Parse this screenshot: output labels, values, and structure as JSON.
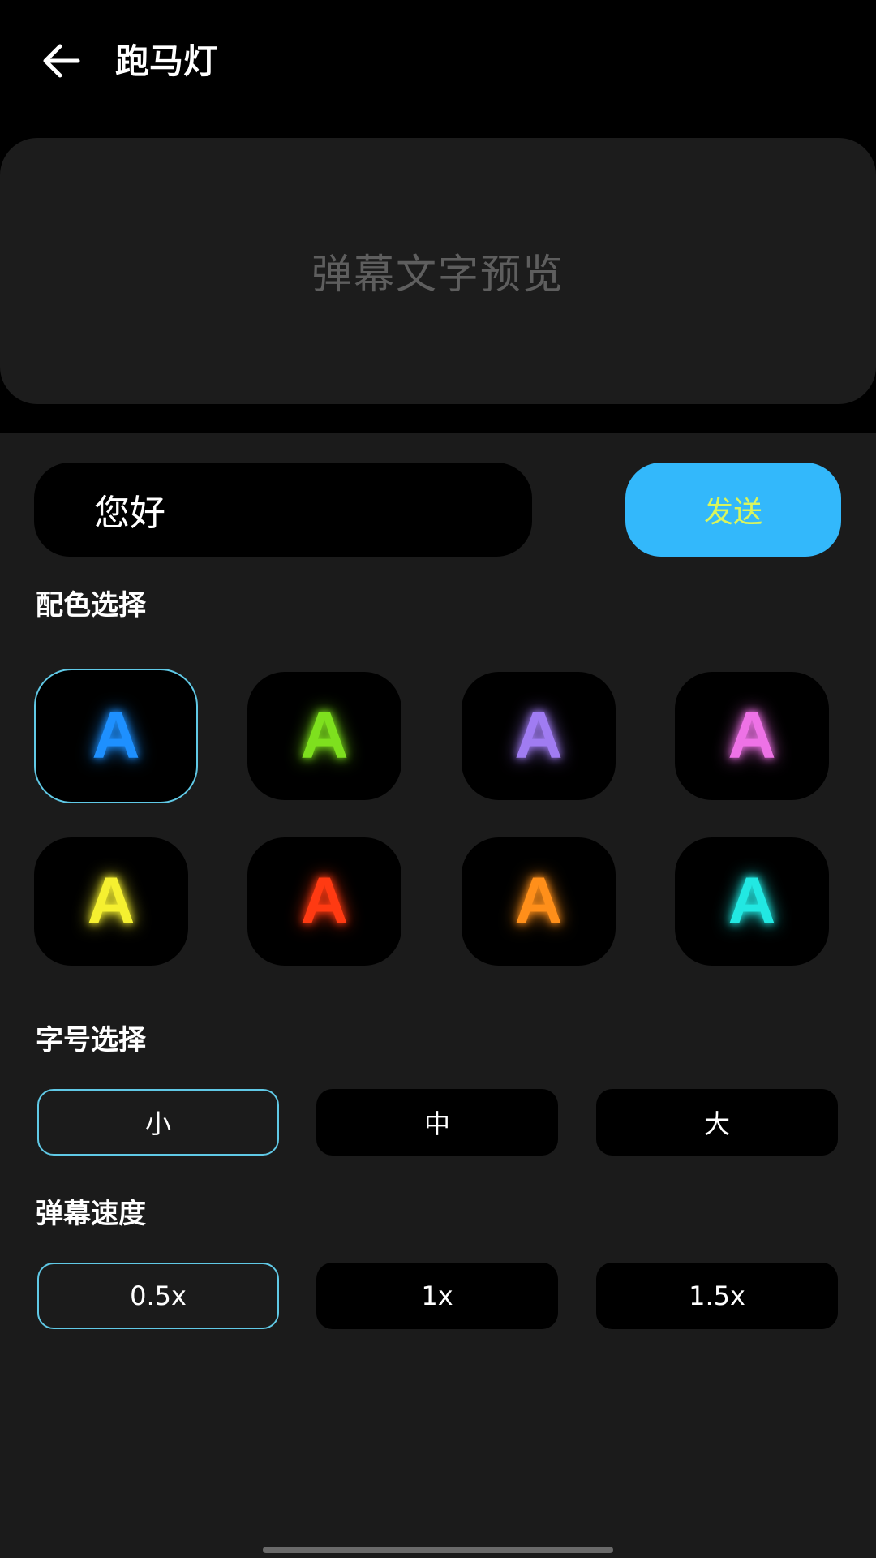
{
  "header": {
    "back_icon": "arrow-left-icon",
    "title": "跑马灯"
  },
  "preview": {
    "text": "弹幕文字预览"
  },
  "input": {
    "value": "您好",
    "send_label": "发送"
  },
  "colors": {
    "label": "配色选择",
    "selected_index": 0,
    "items": [
      {
        "letter": "A",
        "color": "#1e90ff"
      },
      {
        "letter": "A",
        "color": "#7ee01e"
      },
      {
        "letter": "A",
        "color": "#a07cf2"
      },
      {
        "letter": "A",
        "color": "#ee72e6"
      },
      {
        "letter": "A",
        "color": "#f5f030"
      },
      {
        "letter": "A",
        "color": "#ff3a12"
      },
      {
        "letter": "A",
        "color": "#ff8f1a"
      },
      {
        "letter": "A",
        "color": "#22e8e2"
      }
    ]
  },
  "font_size": {
    "label": "字号选择",
    "selected": "小",
    "options": [
      "小",
      "中",
      "大"
    ]
  },
  "speed": {
    "label": "弹幕速度",
    "selected": "0.5x",
    "options": [
      "0.5x",
      "1x",
      "1.5x"
    ]
  },
  "theme": {
    "accent": "#33b8fb",
    "selected_border": "#60c9e6"
  }
}
